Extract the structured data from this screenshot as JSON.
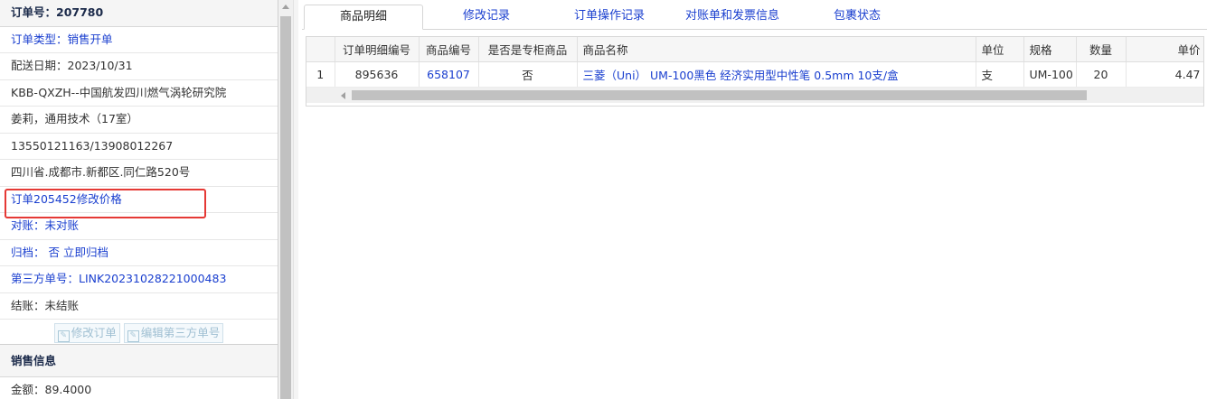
{
  "order": {
    "number_label": "订单号：",
    "number": "207780",
    "fields": [
      "订单类型：销售开单",
      "配送日期：2023/10/31",
      "KBB-QXZH--中国航发四川燃气涡轮研究院",
      "姜莉，通用技术（17室）",
      "13550121163/13908012267",
      "四川省.成都市.新都区.同仁路520号",
      "订单205452修改价格",
      "对账：未对账",
      "归档：  否 立即归档",
      "第三方单号：LINK20231028221000483",
      "结账：未结账"
    ],
    "buttons": {
      "edit_order": "修改订单",
      "edit_third_party": "编辑第三方单号"
    }
  },
  "sales": {
    "title": "销售信息",
    "amount": "金额：89.4000"
  },
  "tabs": [
    "商品明细",
    "修改记录",
    "订单操作记录",
    "对账单和发票信息",
    "包裹状态"
  ],
  "grid": {
    "columns": [
      "",
      "订单明细编号",
      "商品编号",
      "是否是专柜商品",
      "商品名称",
      "单位",
      "规格",
      "数量",
      "单价"
    ],
    "rows": [
      [
        "1",
        "895636",
        "658107",
        "否",
        "三菱（Uni） UM-100黑色 经济实用型中性笔 0.5mm 10支/盒",
        "支",
        "UM-100",
        "20",
        "4.47"
      ]
    ]
  },
  "colors": {
    "link": "#1a3fcf",
    "highlight_box": "#e53935"
  },
  "icons": {
    "edit": "edit-icon"
  }
}
